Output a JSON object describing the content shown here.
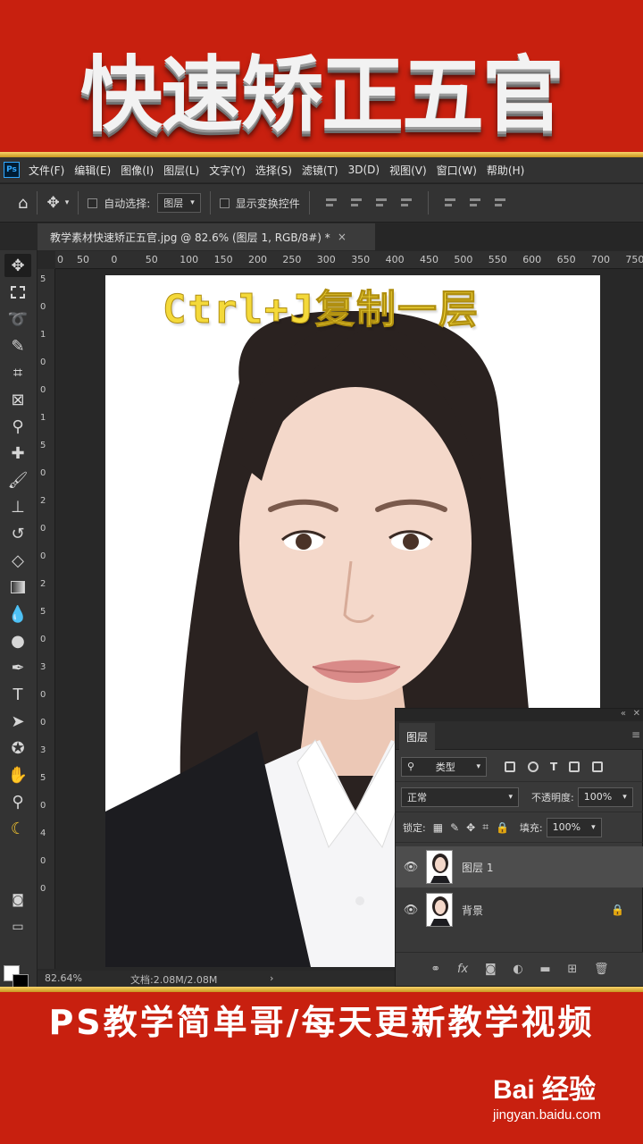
{
  "banner": {
    "title": "快速矫正五官",
    "bottom_text": "PS教学简单哥/每天更新教学视频"
  },
  "watermark": {
    "logo_text": "Bai 经验",
    "url": "jingyan.baidu.com"
  },
  "app": {
    "logo": "Ps",
    "menu": [
      "文件(F)",
      "编辑(E)",
      "图像(I)",
      "图层(L)",
      "文字(Y)",
      "选择(S)",
      "滤镜(T)",
      "3D(D)",
      "视图(V)",
      "窗口(W)",
      "帮助(H)"
    ],
    "options": {
      "auto_select_label": "自动选择:",
      "auto_select_value": "图层",
      "show_transform_label": "显示变换控件"
    },
    "document_tab": {
      "title": "教学素材快速矫正五官.jpg @ 82.6% (图层 1, RGB/8#) *",
      "close": "×"
    },
    "ruler_h_labels": [
      "0",
      "50",
      "0",
      "50",
      "100",
      "150",
      "200",
      "250",
      "300",
      "350",
      "400",
      "450",
      "500",
      "550",
      "600",
      "650",
      "700",
      "750"
    ],
    "ruler_v_labels": [
      "5",
      "0",
      "1",
      "0",
      "0",
      "1",
      "5",
      "0",
      "2",
      "0",
      "0",
      "2",
      "5",
      "0",
      "3",
      "0",
      "0",
      "3",
      "5",
      "0",
      "4",
      "0",
      "0"
    ],
    "canvas_caption": "Ctrl+J复制一层",
    "status": {
      "zoom": "82.64%",
      "doc": "文档:2.08M/2.08M"
    }
  },
  "layers_panel": {
    "tab": "图层",
    "filter_kind": "类型",
    "blend_mode": "正常",
    "opacity_label": "不透明度:",
    "opacity_value": "100%",
    "lock_label": "锁定:",
    "fill_label": "填充:",
    "fill_value": "100%",
    "layers": [
      {
        "name": "图层 1",
        "selected": true
      },
      {
        "name": "背景",
        "selected": false,
        "locked": true
      }
    ]
  },
  "colors": {
    "banner_red": "#c8200f",
    "gold": "#f4d93a",
    "ps_bg": "#282828"
  }
}
